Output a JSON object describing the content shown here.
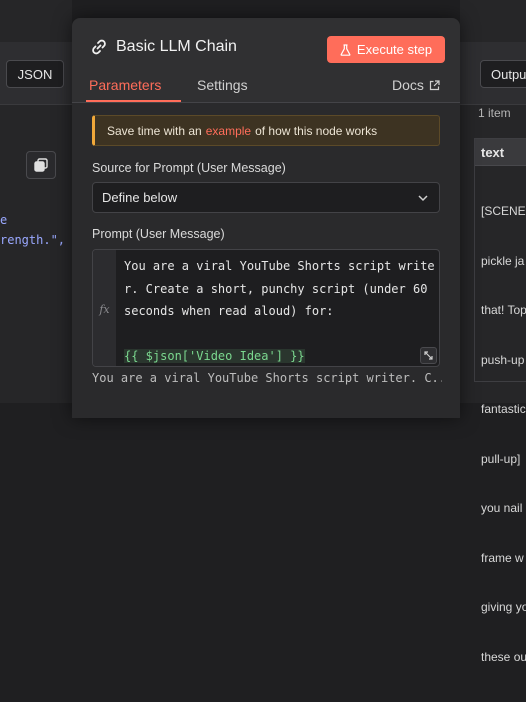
{
  "left_panel": {
    "json_label": "JSON",
    "code_line1": "e",
    "code_line2": "rength.\","
  },
  "modal": {
    "title": "Basic LLM Chain",
    "execute_label": "Execute step",
    "tabs": [
      {
        "label": "Parameters",
        "active": true
      },
      {
        "label": "Settings",
        "active": false
      }
    ],
    "docs_label": "Docs",
    "hint": {
      "prefix": "Save time with an",
      "link": "example",
      "suffix": "of how this node works"
    },
    "source_label": "Source for Prompt (User Message)",
    "source_value": "Define below",
    "prompt_label": "Prompt (User Message)",
    "fx_label": "fx",
    "prompt_lines": [
      "You are a viral YouTube Shorts script write",
      "r. Create a short, punchy script (under 60",
      "seconds when read aloud) for:",
      ""
    ],
    "prompt_expression": "{{ $json['Video Idea'] }}",
    "preview": "You are a viral YouTube Shorts script writer. C..."
  },
  "right_panel": {
    "output_label": "Outpu",
    "item_count": "1 item",
    "column_header": "text",
    "cell_lines": [
      "[SCENE",
      "pickle ja",
      "that! Top",
      "push-up",
      "fantastic",
      "pull-up]",
      "you nail",
      "frame w",
      "giving yo",
      "these ou"
    ]
  },
  "colors": {
    "accent": "#ff6d5a",
    "hint_bar": "#f0a83a",
    "expression": "#7bd88f"
  }
}
